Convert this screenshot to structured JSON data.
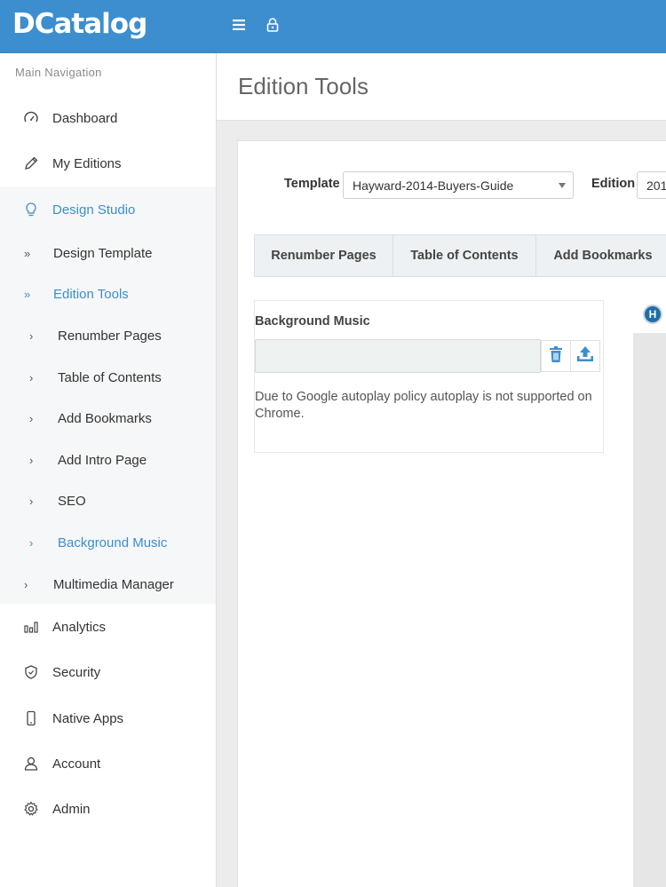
{
  "brand": {
    "logo_text": "DCatalog",
    "color": "#3c8ece"
  },
  "topbar": {
    "menu_icon": "hamburger-icon",
    "lock_icon": "lock-icon"
  },
  "sidebar": {
    "heading": "Main Navigation",
    "items": [
      {
        "label": "Dashboard",
        "icon": "speedometer-icon"
      },
      {
        "label": "My Editions",
        "icon": "pencil-icon"
      },
      {
        "label": "Design Studio",
        "icon": "lightbulb-icon",
        "active": true
      },
      {
        "label": "Analytics",
        "icon": "bar-chart-icon"
      },
      {
        "label": "Security",
        "icon": "shield-icon"
      },
      {
        "label": "Native Apps",
        "icon": "mobile-icon"
      },
      {
        "label": "Account",
        "icon": "user-icon"
      },
      {
        "label": "Admin",
        "icon": "gear-icon"
      }
    ],
    "design_studio_children": [
      {
        "label": "Design Template"
      },
      {
        "label": "Edition Tools",
        "active": true
      },
      {
        "label": "Multimedia Manager"
      }
    ],
    "edition_tools_children": [
      {
        "label": "Renumber Pages"
      },
      {
        "label": "Table of Contents"
      },
      {
        "label": "Add Bookmarks"
      },
      {
        "label": "Add Intro Page"
      },
      {
        "label": "SEO"
      },
      {
        "label": "Background Music",
        "active": true
      }
    ]
  },
  "page": {
    "title": "Edition Tools",
    "template_label": "Template",
    "template_value": "Hayward-2014-Buyers-Guide",
    "edition_label": "Edition",
    "edition_value": "201",
    "tabs": [
      "Renumber Pages",
      "Table of Contents",
      "Add Bookmarks"
    ],
    "music": {
      "label": "Background Music",
      "input_value": "",
      "delete_icon": "trash-icon",
      "upload_icon": "upload-icon",
      "note": "Due to Google autoplay policy autoplay is not supported on Chrome."
    },
    "preview_badge": "H"
  }
}
